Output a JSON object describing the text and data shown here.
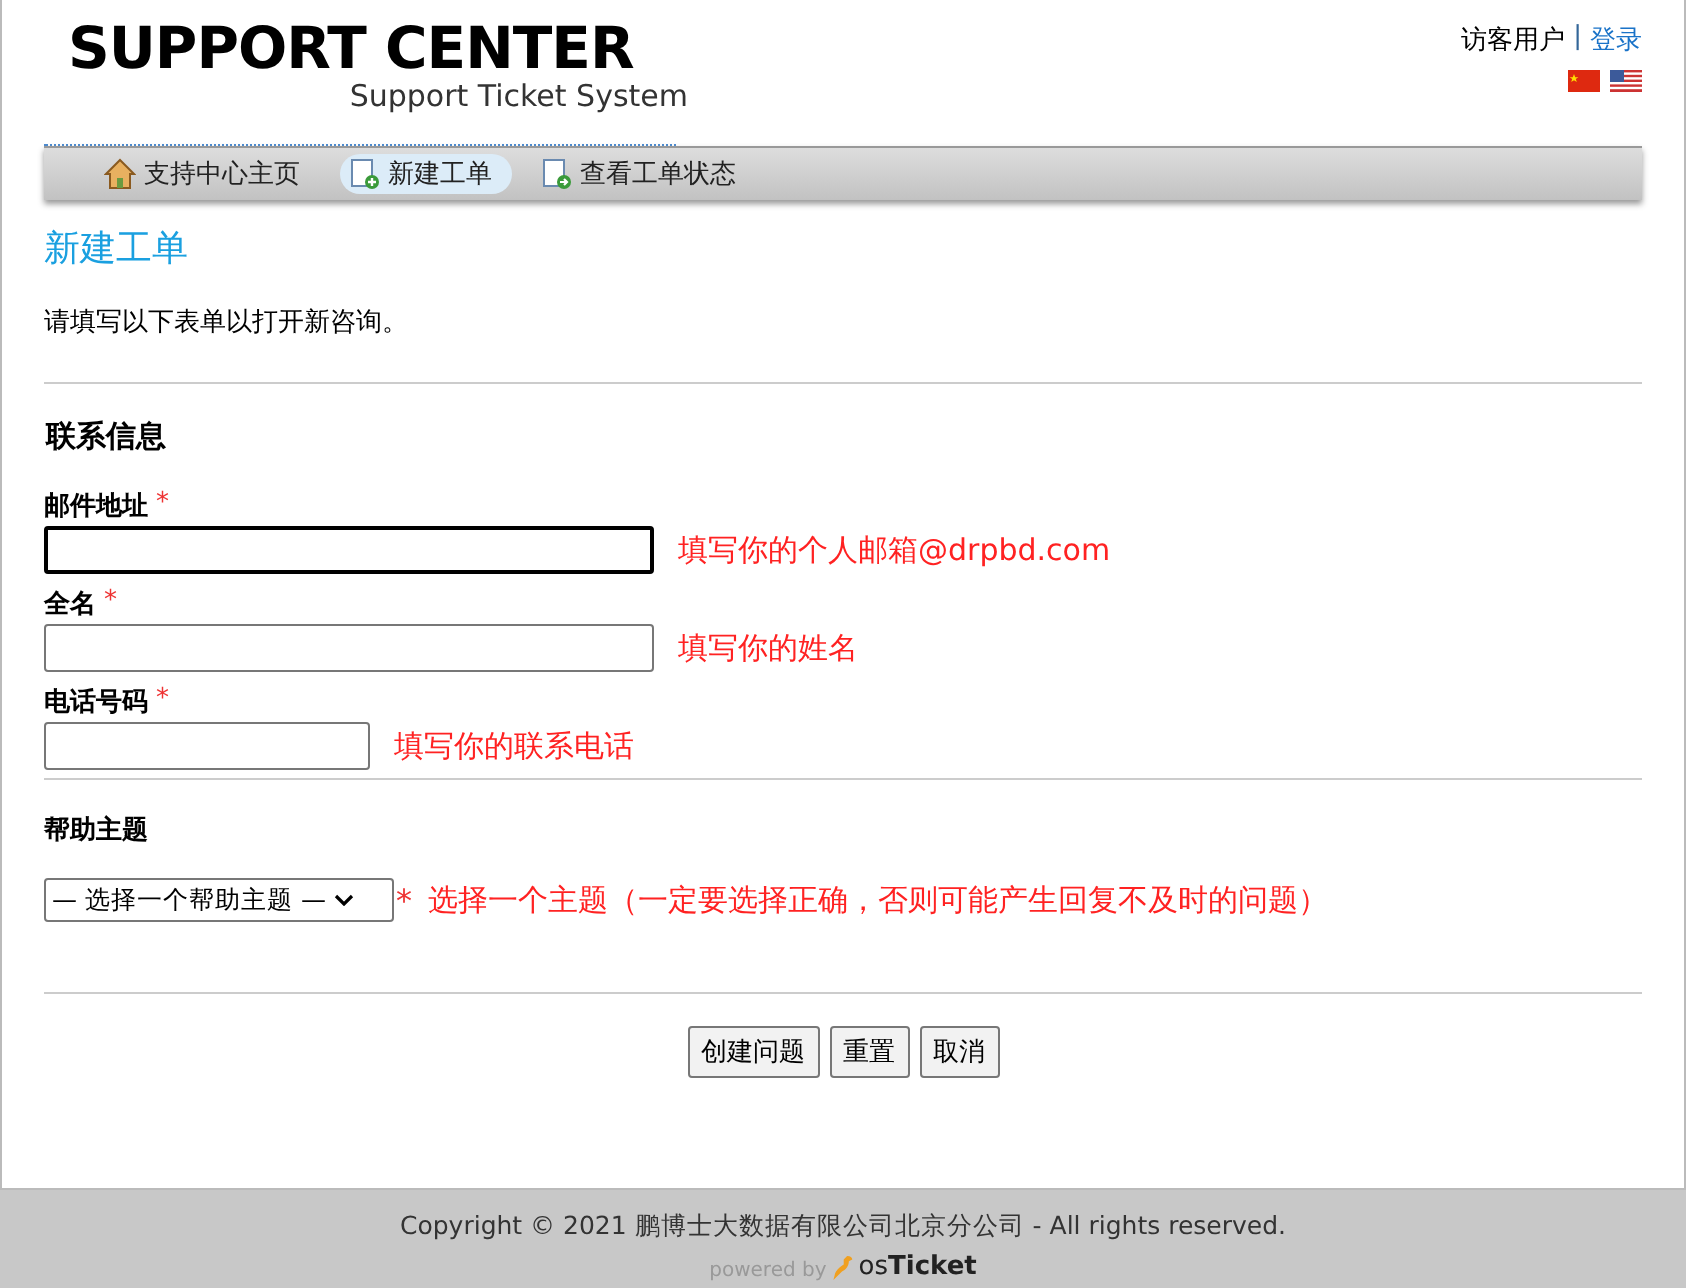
{
  "header": {
    "logo_title": "SUPPORT CENTER",
    "logo_subtitle": "Support Ticket System",
    "user_label": "访客用户",
    "separator": "|",
    "login_link": "登录",
    "flags": [
      {
        "kind": "cn"
      },
      {
        "kind": "us"
      }
    ]
  },
  "nav": [
    {
      "label": "支持中心主页",
      "kind": "home",
      "selected": false
    },
    {
      "label": "新建工单",
      "kind": "new",
      "selected": true
    },
    {
      "label": "查看工单状态",
      "kind": "status",
      "selected": false
    }
  ],
  "page_title": "新建工单",
  "intro": "请填写以下表单以打开新咨询。",
  "section_title": "联系信息",
  "fields": [
    {
      "label": "邮件地址",
      "required_mark": "*",
      "kind": "wide",
      "focused": true,
      "hint": "填写你的个人邮箱@drpbd.com"
    },
    {
      "label": "全名",
      "required_mark": "*",
      "kind": "wide",
      "focused": false,
      "hint": "填写你的姓名"
    },
    {
      "label": "电话号码",
      "required_mark": "*",
      "kind": "narrow",
      "focused": false,
      "hint": "填写你的联系电话"
    }
  ],
  "help_topic": {
    "label": "帮助主题",
    "value": "— 选择一个帮助主题 —",
    "required_mark": "*",
    "hint": "选择一个主题（一定要选择正确，否则可能产生回复不及时的问题）"
  },
  "buttons": [
    "创建问题",
    "重置",
    "取消"
  ],
  "footer": {
    "copyright": "Copyright © 2021 鹏博士大数据有限公司北京分公司 - All rights reserved.",
    "powered_by": "powered by",
    "brand_prefix": "os",
    "brand_name": "Ticket"
  }
}
